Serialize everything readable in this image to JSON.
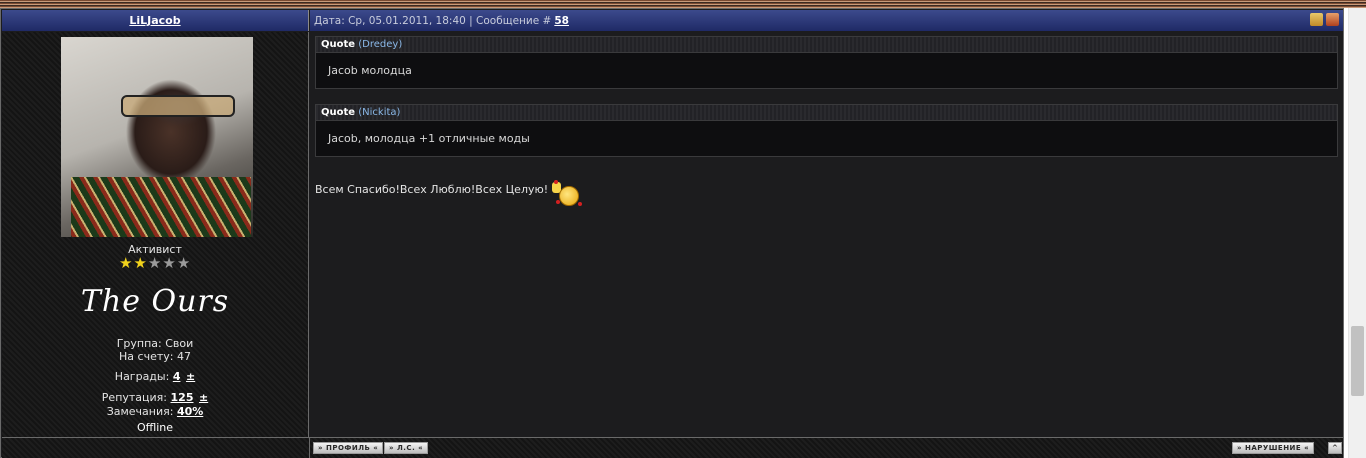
{
  "author": {
    "name": "LiLJacob"
  },
  "post_header": {
    "date_label": "Дата:",
    "date_value": "Ср, 05.01.2011, 18:40",
    "separator": "|",
    "message_label": "Сообщение #",
    "message_number": "58"
  },
  "profile": {
    "rank": "Активист",
    "stars_filled": 2,
    "stars_total": 5,
    "clan": "The Ours",
    "group_label": "Группа:",
    "group_value": "Свои",
    "account_label": "На счету:",
    "account_value": "47",
    "awards_label": "Награды:",
    "awards_value": "4",
    "awards_plus": "±",
    "reputation_label": "Репутация:",
    "reputation_value": "125",
    "reputation_plus": "±",
    "warnings_label": "Замечания:",
    "warnings_value": "40%",
    "status": "Offline"
  },
  "quotes": [
    {
      "label": "Quote",
      "author": "(Dredey)",
      "text": "Jacob молодца"
    },
    {
      "label": "Quote",
      "author": "(Nickita)",
      "text": "Jacob, молодца +1 отличные моды"
    }
  ],
  "message": "Всем Спасибо!Всех Люблю!Всех Целую!",
  "footer": {
    "profile_button": "» ПРОФИЛЬ «",
    "pm_button": "» Л.С. «",
    "report_button": "» НАРУШЕНИЕ «",
    "top_button": "^"
  },
  "icons": {
    "thumb_up": "thumb-up-icon",
    "thumb_down": "thumb-down-icon",
    "star": "star-icon",
    "smiley": "waving-smiley-icon"
  },
  "colors": {
    "header": "#2a3577",
    "background": "#1c1c1e",
    "star_on": "#f1d21c"
  }
}
